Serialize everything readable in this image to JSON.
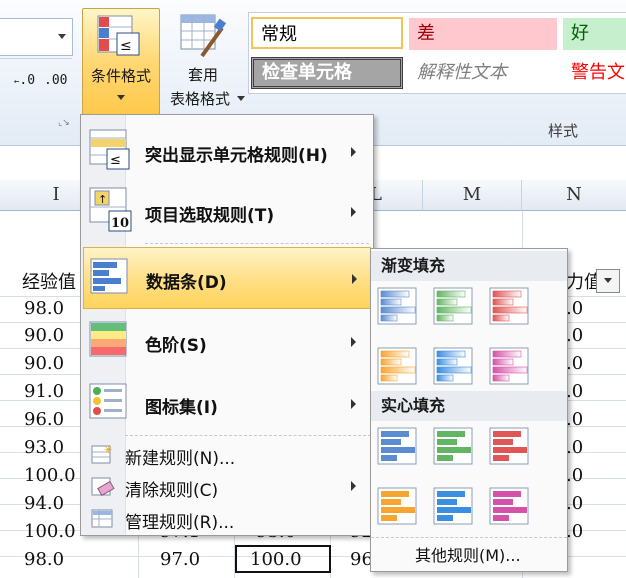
{
  "ribbon": {
    "decrease_label": ".00",
    "increase_label": ".0",
    "cond_format": {
      "line1": "条件格式",
      "icon": "conditional-formatting-icon"
    },
    "table_format": {
      "line1": "套用",
      "line2": "表格格式"
    },
    "styles": {
      "normal": "常规",
      "bad": "差",
      "good": "好",
      "check_cell": "检查单元格",
      "explanatory": "解释性文本",
      "warning": "警告文",
      "group_label": "样式"
    },
    "colors": {
      "bad_bg": "#ffc7ce",
      "bad_fg": "#9c0006",
      "good_bg": "#c6efce",
      "good_fg": "#006100",
      "check_bg": "#a5a5a5",
      "warning_fg": "#ff0000",
      "highlight": "#ffd35b"
    }
  },
  "sheet": {
    "col_I": "I",
    "col_L": "L",
    "col_M": "M",
    "col_N": "N",
    "header_I": "经验值",
    "header_N": "力值",
    "col_I_values": [
      "98.0",
      "90.0",
      "90.0",
      "91.0",
      "96.0",
      "93.0",
      "100.0",
      "94.0",
      "100.0",
      "98.0"
    ],
    "row9_J": "97.1",
    "row9_K": "95.0",
    "row9_L": "92",
    "row10_J": "97.0",
    "row10_K": "100.0",
    "row10_L": "96",
    "col_N_values": [
      ".0",
      ".0",
      ".0",
      ".0",
      ".0",
      ".0",
      ".0",
      ".0",
      ".0"
    ]
  },
  "menu": {
    "items": [
      {
        "label": "突出显示单元格规则(H)",
        "icon": "highlight-cells-rules-icon"
      },
      {
        "label": "项目选取规则(T)",
        "icon": "top-bottom-rules-icon"
      },
      {
        "label": "数据条(D)",
        "icon": "data-bars-icon"
      },
      {
        "label": "色阶(S)",
        "icon": "color-scales-icon"
      },
      {
        "label": "图标集(I)",
        "icon": "icon-sets-icon"
      }
    ],
    "small_items": [
      {
        "label": "新建规则(N)...",
        "icon": "new-rule-icon"
      },
      {
        "label": "清除规则(C)",
        "icon": "clear-rules-icon"
      },
      {
        "label": "管理规则(R)...",
        "icon": "manage-rules-icon"
      }
    ]
  },
  "submenu": {
    "gradient_title": "渐变填充",
    "solid_title": "实心填充",
    "more_rules": "其他规则(M)...",
    "bar_colors": [
      "#5b8bd0",
      "#63b563",
      "#e05555",
      "#f6a531",
      "#3b8ee0",
      "#d552a8"
    ]
  }
}
